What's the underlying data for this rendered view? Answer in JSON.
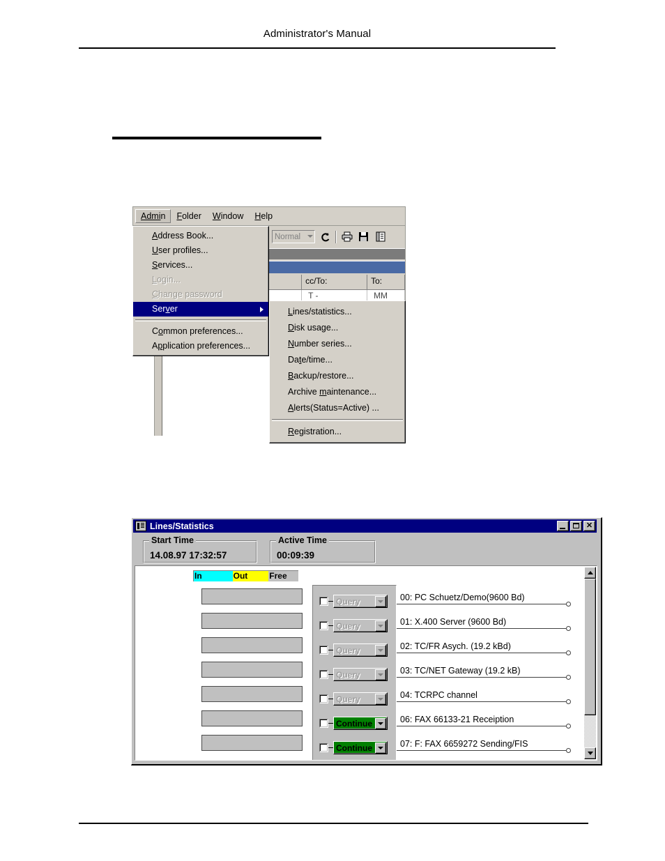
{
  "page": {
    "header_title": "Administrator's Manual"
  },
  "menu_capture": {
    "menubar": [
      {
        "label": "Admin",
        "accel_index": 4,
        "active": true
      },
      {
        "label": "Folder",
        "accel_index": 0,
        "active": false
      },
      {
        "label": "Window",
        "accel_index": 0,
        "active": false
      },
      {
        "label": "Help",
        "accel_index": 0,
        "active": false
      }
    ],
    "admin_menu": [
      {
        "label": "Address Book...",
        "accel_index": 0,
        "state": "normal",
        "submenu": false
      },
      {
        "label": "User profiles...",
        "accel_index": 0,
        "state": "normal",
        "submenu": false
      },
      {
        "label": "Services...",
        "accel_index": 0,
        "state": "normal",
        "submenu": false
      },
      {
        "label": "Login...",
        "accel_index": 0,
        "state": "disabled",
        "submenu": false
      },
      {
        "label": "Change password",
        "accel_index": 0,
        "state": "disabled",
        "submenu": false
      },
      {
        "label": "Server",
        "accel_index": 3,
        "state": "highlight",
        "submenu": true
      },
      {
        "separator": true
      },
      {
        "label": "Common preferences...",
        "accel_index": 2,
        "state": "normal",
        "submenu": false
      },
      {
        "label": "Application preferences...",
        "accel_index": 1,
        "state": "normal",
        "submenu": false
      }
    ],
    "server_submenu": [
      {
        "label": "Lines/statistics...",
        "accel_index": 0
      },
      {
        "label": "Disk usage...",
        "accel_index": 0
      },
      {
        "label": "Number series...",
        "accel_index": 0
      },
      {
        "label": "Date/time...",
        "accel_index": 2
      },
      {
        "label": "Backup/restore...",
        "accel_index": 0
      },
      {
        "label": "Archive maintenance...",
        "accel_index": 8
      },
      {
        "label": "Alerts(Status=Active) ...",
        "accel_index": 0
      },
      {
        "separator": true
      },
      {
        "label": "Registration...",
        "accel_index": 0
      }
    ],
    "toolbar": {
      "style_combo_value": "Normal",
      "icons": [
        "refresh-icon",
        "print-icon",
        "save-icon",
        "notes-icon"
      ]
    },
    "grid": {
      "headers": [
        "",
        "cc/To:",
        "To:"
      ],
      "row": [
        "",
        "T -",
        "MM"
      ]
    }
  },
  "lines_dialog": {
    "title": "Lines/Statistics",
    "window_buttons": {
      "minimize": "minimize-icon",
      "maximize": "maximize-icon",
      "close": "✕"
    },
    "start_time": {
      "label": "Start Time",
      "value": "14.08.97 17:32:57"
    },
    "active_time": {
      "label": "Active Time",
      "value": "00:09:39"
    },
    "legend": [
      {
        "label": "In",
        "color": "#00ffff"
      },
      {
        "label": "Out",
        "color": "#ffff00"
      },
      {
        "label": "Free",
        "color": "#c0c0c0"
      }
    ],
    "bar_count": 7,
    "lines": [
      {
        "checked": false,
        "state": "Query",
        "label": "00:  PC Schuetz/Demo(9600 Bd)"
      },
      {
        "checked": false,
        "state": "Query",
        "label": "01:  X.400 Server (9600 Bd)"
      },
      {
        "checked": false,
        "state": "Query",
        "label": "02:  TC/FR Asych. (19.2 kBd)"
      },
      {
        "checked": false,
        "state": "Query",
        "label": "03:  TC/NET Gateway (19.2 kB)"
      },
      {
        "checked": false,
        "state": "Query",
        "label": "04:  TCRPC channel"
      },
      {
        "checked": false,
        "state": "Continue",
        "label": "06:  FAX 66133-21 Receiption"
      },
      {
        "checked": false,
        "state": "Continue",
        "label": "07: F: FAX 6659272 Sending/FIS"
      }
    ],
    "colors": {
      "continue_bg": "#008000",
      "title_bg": "#000080",
      "face": "#c0c0c0"
    }
  }
}
